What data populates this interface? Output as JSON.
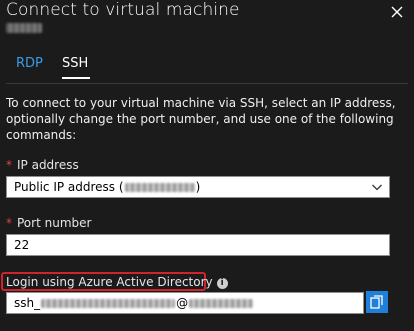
{
  "header": {
    "title": "Connect to virtual machine",
    "close_icon": "close-icon"
  },
  "tabs": [
    {
      "label": "RDP",
      "active": false
    },
    {
      "label": "SSH",
      "active": true
    }
  ],
  "description": "To connect to your virtual machine via SSH, select an IP address, optionally change the port number, and use one of the following commands:",
  "ip_address": {
    "label": "IP address",
    "required_mark": "*",
    "value_prefix": "Public IP address (",
    "value_suffix": ")"
  },
  "port": {
    "label": "Port number",
    "required_mark": "*",
    "value": "22"
  },
  "login": {
    "label": "Login using Azure Active Directory",
    "info_icon": "info-icon",
    "command_prefix": "ssh_",
    "command_at": "@"
  },
  "copy_icon": "copy-icon",
  "colors": {
    "background": "#1b1b1c",
    "accent": "#3b9be8",
    "highlight": "#d1232b",
    "copy_button": "#1f7fd9",
    "required": "#e3423a"
  }
}
